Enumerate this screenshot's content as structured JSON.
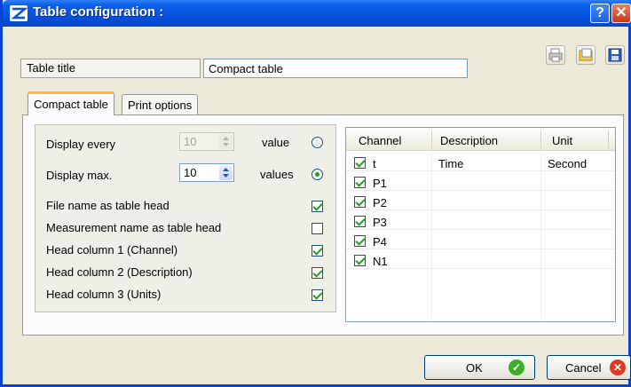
{
  "window": {
    "title": "Table configuration :"
  },
  "titlebar": {
    "help_glyph": "?",
    "close_glyph": "✕"
  },
  "toolbar_icons": [
    "printer-icon",
    "export-icon",
    "save-icon"
  ],
  "table_title": {
    "label": "Table title",
    "value": "Compact table"
  },
  "tabs": [
    {
      "label": "Compact table",
      "active": true
    },
    {
      "label": "Print options",
      "active": false
    }
  ],
  "settings": {
    "display_every": {
      "label": "Display every",
      "value": "10",
      "unit": "value",
      "selected": false,
      "disabled": true
    },
    "display_max": {
      "label": "Display max.",
      "value": "10",
      "unit": "values",
      "selected": true,
      "disabled": false
    },
    "checkboxes": [
      {
        "label": "File name as table head",
        "checked": true
      },
      {
        "label": "Measurement name as table head",
        "checked": false
      },
      {
        "label": "Head column 1 (Channel)",
        "checked": true
      },
      {
        "label": "Head column 2 (Description)",
        "checked": true
      },
      {
        "label": "Head column 3 (Units)",
        "checked": true
      }
    ]
  },
  "channel_grid": {
    "columns": [
      "Channel",
      "Description",
      "Unit"
    ],
    "rows": [
      {
        "channel": "t",
        "description": "Time",
        "unit": "Second",
        "checked": true
      },
      {
        "channel": "P1",
        "description": "",
        "unit": "",
        "checked": true
      },
      {
        "channel": "P2",
        "description": "",
        "unit": "",
        "checked": true
      },
      {
        "channel": "P3",
        "description": "",
        "unit": "",
        "checked": true
      },
      {
        "channel": "P4",
        "description": "",
        "unit": "",
        "checked": true
      },
      {
        "channel": "N1",
        "description": "",
        "unit": "",
        "checked": true
      }
    ]
  },
  "buttons": {
    "ok": "OK",
    "cancel": "Cancel"
  },
  "colors": {
    "titlebar": "#0553df",
    "active_tab_accent": "#f9b641",
    "check": "#21a121",
    "ok_icon": "#3fae2a",
    "cancel_icon": "#e03a22"
  }
}
